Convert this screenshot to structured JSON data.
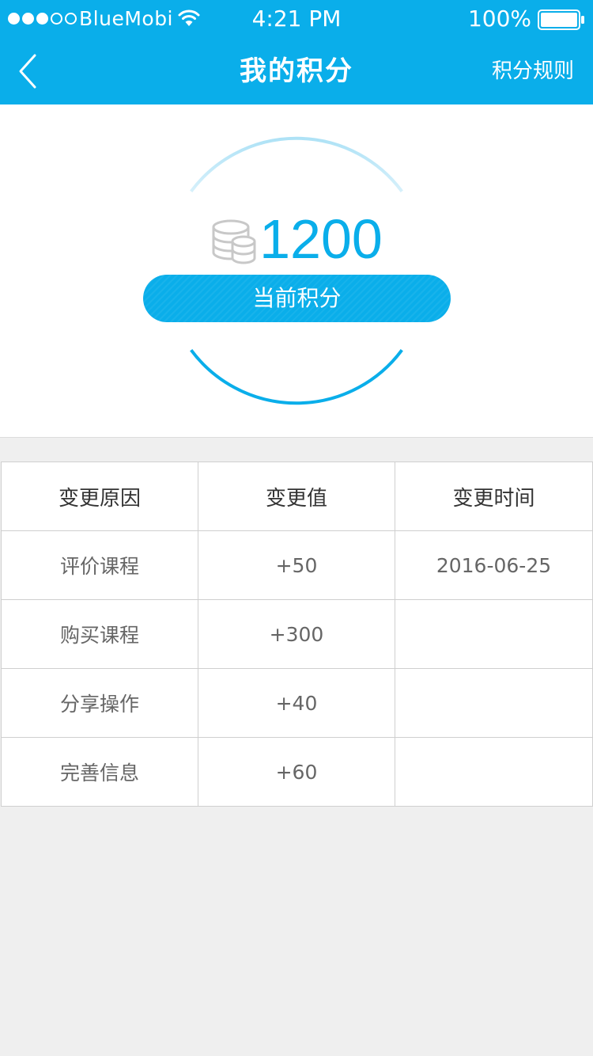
{
  "status_bar": {
    "carrier": "BlueMobi",
    "time": "4:21 PM",
    "battery": "100%",
    "signal_bars": 3,
    "signal_total": 5
  },
  "nav": {
    "title": "我的积分",
    "right_action": "积分规则",
    "back_icon": "chevron-left-icon"
  },
  "points": {
    "value": "1200",
    "label": "当前积分",
    "icon": "coins-icon"
  },
  "table": {
    "headers": [
      "变更原因",
      "变更值",
      "变更时间"
    ],
    "rows": [
      {
        "reason": "评价课程",
        "value": "+50",
        "time": "2016-06-25"
      },
      {
        "reason": "购买课程",
        "value": "+300",
        "time": ""
      },
      {
        "reason": "分享操作",
        "value": "+40",
        "time": ""
      },
      {
        "reason": "完善信息",
        "value": "+60",
        "time": ""
      }
    ]
  },
  "colors": {
    "brand": "#0aaeea",
    "background": "#efefef",
    "text": "#333333",
    "muted_text": "#666666"
  }
}
